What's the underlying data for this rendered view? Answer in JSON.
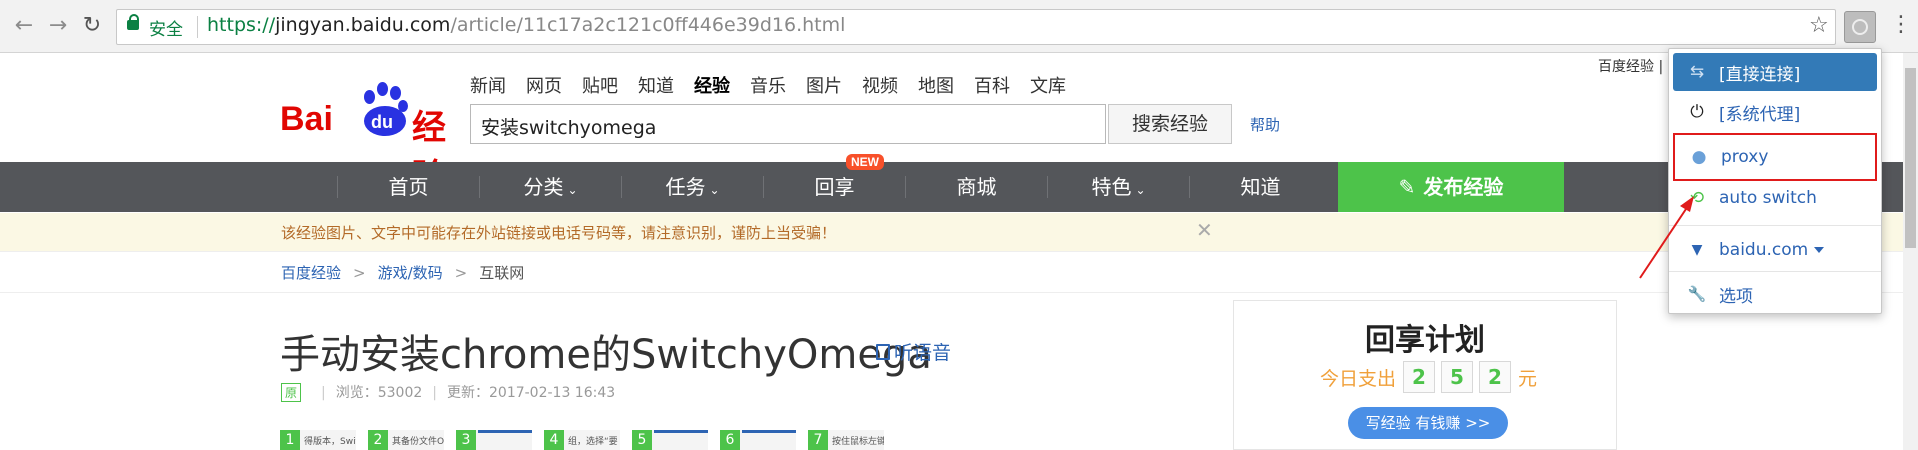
{
  "browser": {
    "secure_label": "安全",
    "url_scheme": "https://",
    "url_host": "jingyan.baidu.com",
    "url_path": "/article/11c17a2c121c0ff446e39d16.html",
    "back_icon": "←",
    "forward_icon": "→",
    "reload_icon": "↻",
    "star_icon": "☆",
    "menu_icon": "⋮"
  },
  "header": {
    "logo_bai": "Bai",
    "logo_du": "du",
    "logo_jy": "经验",
    "top_nav": [
      "新闻",
      "网页",
      "贴吧",
      "知道",
      "经验",
      "音乐",
      "图片",
      "视频",
      "地图",
      "百科",
      "文库"
    ],
    "search_value": "安装switchyomega",
    "search_button": "搜索经验",
    "help": "帮助",
    "top_right_link": "百度经验 |"
  },
  "main_nav": {
    "items": [
      "首页",
      "分类",
      "任务",
      "回享",
      "商城",
      "特色",
      "知道"
    ],
    "dropdown_items": [
      "分类",
      "任务",
      "特色"
    ],
    "new_badge": "NEW",
    "publish": "发布经验"
  },
  "notice": {
    "text": "该经验图片、文字中可能存在外站链接或电话号码等，请注意识别，谨防上当受骗！",
    "close_icon": "✕"
  },
  "breadcrumb": {
    "items": [
      "百度经验",
      "游戏/数码",
      "互联网"
    ]
  },
  "article": {
    "title": "手动安装chrome的SwitchyOmega",
    "listen": "听语音",
    "original_badge": "原",
    "views": "浏览：53002",
    "updated": "更新：2017-02-13 16:43",
    "thumbs": [
      {
        "num": "1",
        "caption": "得版本，Switchy!"
      },
      {
        "num": "2",
        "caption": "其备份文件On"
      },
      {
        "num": "3",
        "caption": ""
      },
      {
        "num": "4",
        "caption": "组，选择“要"
      },
      {
        "num": "5",
        "caption": ""
      },
      {
        "num": "6",
        "caption": ""
      },
      {
        "num": "7",
        "caption": "按住鼠标左键"
      }
    ]
  },
  "ad": {
    "title": "回享计划",
    "pay_label": "今日支出",
    "digits": [
      "2",
      "5",
      "2"
    ],
    "unit": "元",
    "button": "写经验 有钱赚 >>"
  },
  "proxy_popup": {
    "items": [
      {
        "label": "[直接连接]",
        "icon": "⇆"
      },
      {
        "label": "[系统代理]",
        "icon": "⏻"
      },
      {
        "label": "proxy",
        "icon": "●"
      },
      {
        "label": "auto switch",
        "icon": "⟲"
      },
      {
        "label": "baidu.com",
        "icon": "▼"
      },
      {
        "label": "选项",
        "icon": "🔧"
      }
    ],
    "colors": {
      "active_bg": "#337ab7",
      "highlight_border": "#e01b1b",
      "proxy_icon": "#6aa0d8",
      "auto_icon": "#4dc34a"
    }
  }
}
